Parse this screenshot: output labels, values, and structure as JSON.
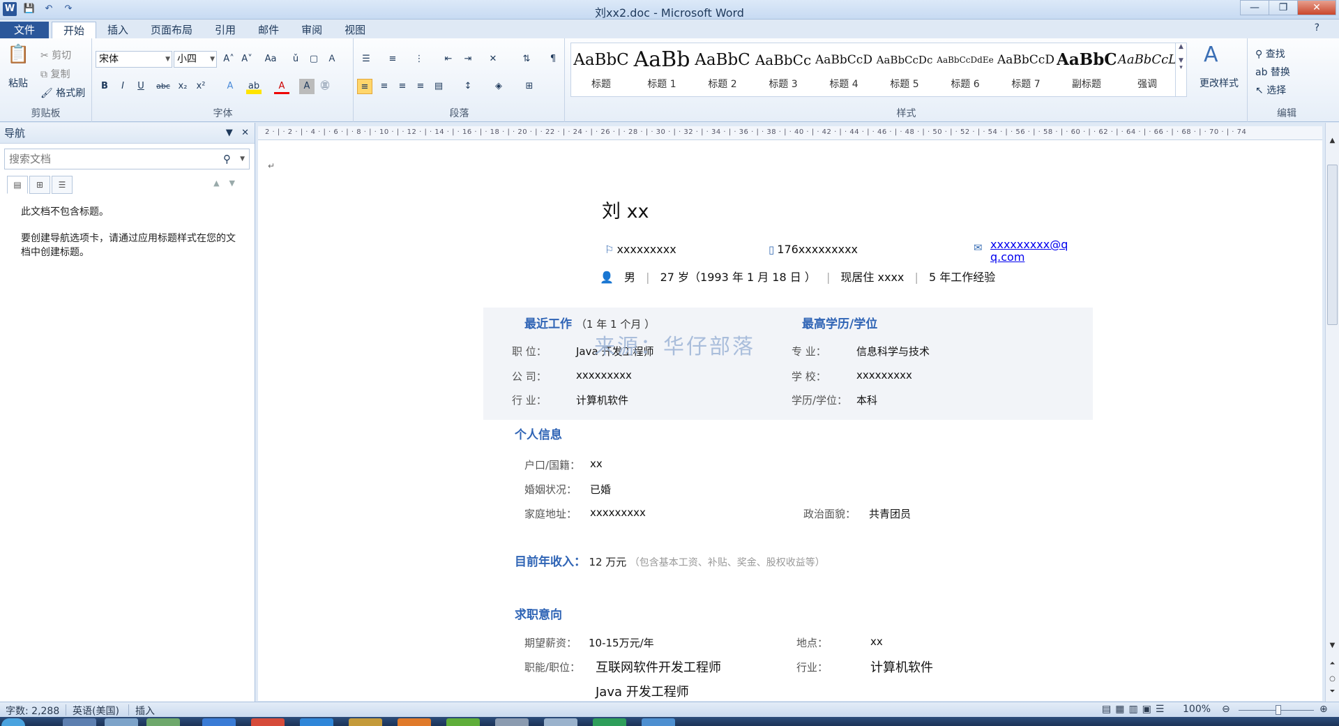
{
  "window": {
    "title": "刘xx2.doc - Microsoft Word",
    "controls": {
      "minimize": "—",
      "maximize": "❐",
      "close": "✕"
    }
  },
  "qat": {
    "logo": "W",
    "save": "💾",
    "undo": "↶",
    "redo": "↷"
  },
  "tabs": {
    "file": "文件",
    "items": [
      "开始",
      "插入",
      "页面布局",
      "引用",
      "邮件",
      "审阅",
      "视图"
    ]
  },
  "ribbon": {
    "clipboard": {
      "paste": "粘贴",
      "cut": "剪切",
      "copy": "复制",
      "format_painter": "格式刷",
      "label": "剪贴板"
    },
    "font": {
      "font_name": "宋体",
      "font_size": "小四",
      "label": "字体",
      "b": "B",
      "i": "I",
      "u": "U",
      "abc": "abc",
      "sub": "x₂",
      "sup": "x²",
      "grow": "A˄",
      "shrink": "A˅",
      "aa": "Aa"
    },
    "paragraph": {
      "label": "段落"
    },
    "styles": {
      "label": "样式",
      "items": [
        {
          "preview": "AaBbC",
          "name": "标题"
        },
        {
          "preview": "AaBb",
          "name": "标题 1"
        },
        {
          "preview": "AaBbC",
          "name": "标题 2"
        },
        {
          "preview": "AaBbCc",
          "name": "标题 3"
        },
        {
          "preview": "AaBbCcD",
          "name": "标题 4"
        },
        {
          "preview": "AaBbCcDc",
          "name": "标题 5"
        },
        {
          "preview": "AaBbCcDdEe",
          "name": "标题 6"
        },
        {
          "preview": "AaBbCcD",
          "name": "标题 7"
        },
        {
          "preview": "AaBbC",
          "name": "副标题"
        },
        {
          "preview": "AaBbCcL",
          "name": "强调"
        }
      ],
      "change_styles": "更改样式"
    },
    "editing": {
      "find": "查找",
      "replace": "替换",
      "select": "选择",
      "label": "编辑"
    }
  },
  "nav": {
    "title": "导航",
    "search_placeholder": "搜索文档",
    "msg1": "此文档不包含标题。",
    "msg2": "要创建导航选项卡，请通过应用标题样式在您的文档中创建标题。"
  },
  "ruler": {
    "text": "2 · | · 2 · | · 4 · | · 6 · | · 8 · | · 10 · | · 12 · | · 14 · | · 16 · | · 18 · | · 20 · | · 22 · | · 24 · | · 26 · | · 28 · | · 30 · | · 32 · | · 34 · | · 36 · | · 38 · | · 40 · | · 42 · | · 44 · | · 46 · | · 48 · | · 50 · | · 52 · | · 54 · | · 56 · | · 58 · | · 60 · | · 62 · | · 64 · | · 66 · | · 68 · | · 70 · | · 74"
  },
  "doc": {
    "name": "刘 xx",
    "contact": {
      "id": "xxxxxxxxx",
      "phone": "176xxxxxxxxx",
      "email": "xxxxxxxxx@qq.com"
    },
    "info": {
      "gender": "男",
      "age": "27 岁（1993 年 1 月 18 日 ）",
      "residence": "现居住 xxxx",
      "experience": "5 年工作经验"
    },
    "recent_work": {
      "title": "最近工作",
      "duration": "（1 年 1 个月 ）",
      "position_label": "职 位：",
      "position": "Java 开发工程师",
      "company_label": "公 司：",
      "company": "xxxxxxxxx",
      "industry_label": "行 业：",
      "industry": "计算机软件"
    },
    "education": {
      "title": "最高学历/学位",
      "major_label": "专 业：",
      "major": "信息科学与技术",
      "school_label": "学 校：",
      "school": "xxxxxxxxx",
      "degree_label": "学历/学位：",
      "degree": "本科"
    },
    "watermark": "来源：华仔部落",
    "personal": {
      "title": "个人信息",
      "hukou_label": "户口/国籍：",
      "hukou": "xx",
      "marital_label": "婚姻状况：",
      "marital": "已婚",
      "address_label": "家庭地址：",
      "address": "xxxxxxxxx",
      "political_label": "政治面貌：",
      "political": "共青团员"
    },
    "income": {
      "title": "目前年收入：",
      "value": "12 万元",
      "note": "（包含基本工资、补贴、奖金、股权收益等）"
    },
    "intention": {
      "title": "求职意向",
      "salary_label": "期望薪资：",
      "salary": "10-15万元/年",
      "location_label": "地点：",
      "location": "xx",
      "role_label": "职能/职位：",
      "role1": "互联网软件开发工程师",
      "role2": "Java 开发工程师",
      "industry_label": "行业：",
      "industry": "计算机软件"
    }
  },
  "status": {
    "words": "字数: 2,288",
    "language": "英语(美国)",
    "mode": "插入",
    "zoom": "100%"
  }
}
